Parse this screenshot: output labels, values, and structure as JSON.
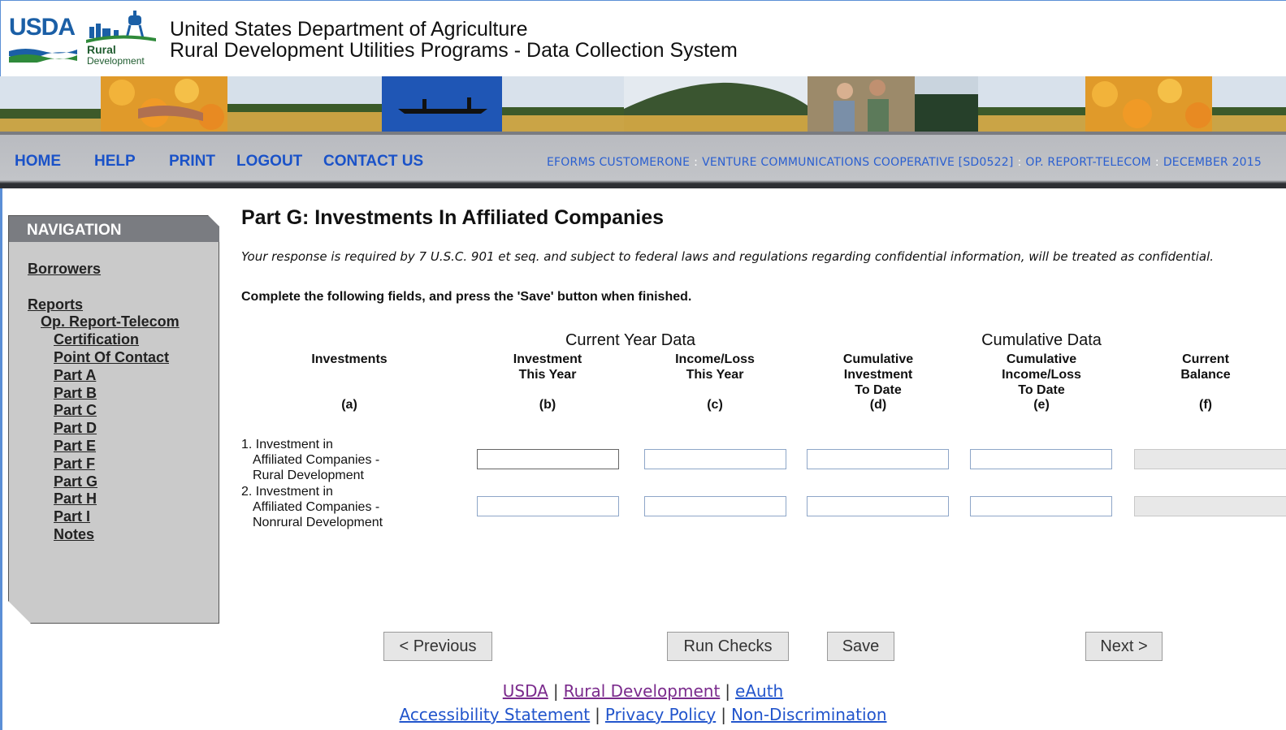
{
  "header": {
    "logo_usda": "USDA",
    "logo_rd_line1": "Rural",
    "logo_rd_line2": "Development",
    "title_line1": "United States Department of Agriculture",
    "title_line2": "Rural Development Utilities Programs - Data Collection System"
  },
  "topnav": {
    "items": [
      {
        "label": "HOME"
      },
      {
        "label": "HELP"
      },
      {
        "label": "PRINT"
      },
      {
        "label": "LOGOUT"
      },
      {
        "label": "CONTACT US"
      }
    ],
    "context": {
      "user": "EFORMS CUSTOMERONE",
      "borrower": "VENTURE COMMUNICATIONS COOPERATIVE [SD0522]",
      "report": "OP. REPORT-TELECOM",
      "period": "DECEMBER 2015",
      "separator": ":"
    }
  },
  "navigation": {
    "title": "NAVIGATION",
    "borrowers": "Borrowers",
    "reports": "Reports",
    "report_name": "Op. Report-Telecom",
    "items": [
      {
        "label": "Certification"
      },
      {
        "label": "Point Of Contact"
      },
      {
        "label": "Part A"
      },
      {
        "label": "Part B"
      },
      {
        "label": "Part C"
      },
      {
        "label": "Part D"
      },
      {
        "label": "Part E"
      },
      {
        "label": "Part F"
      },
      {
        "label": "Part G"
      },
      {
        "label": "Part H"
      },
      {
        "label": "Part I"
      },
      {
        "label": "Notes"
      }
    ]
  },
  "main": {
    "title": "Part G: Investments In Affiliated Companies",
    "notice": "Your response is required by 7 U.S.C. 901 et seq. and subject to federal laws and regulations regarding confidential information, will be treated as confidential.",
    "instructions": "Complete the following fields, and press the 'Save' button when finished.",
    "groups": {
      "current_year": "Current Year Data",
      "cumulative": "Cumulative Data"
    },
    "columns": [
      {
        "line1": "Investments",
        "line2": "",
        "line3": "",
        "letter": "(a)"
      },
      {
        "line1": "Investment",
        "line2": "This Year",
        "line3": "",
        "letter": "(b)"
      },
      {
        "line1": "Income/Loss",
        "line2": "This Year",
        "line3": "",
        "letter": "(c)"
      },
      {
        "line1": "Cumulative",
        "line2": "Investment",
        "line3": "To Date",
        "letter": "(d)"
      },
      {
        "line1": "Cumulative",
        "line2": "Income/Loss",
        "line3": "To Date",
        "letter": "(e)"
      },
      {
        "line1": "Current",
        "line2": "Balance",
        "line3": "",
        "letter": "(f)"
      }
    ],
    "rows": [
      {
        "num": "1.",
        "line1": "Investment in",
        "line2": "Affiliated Companies -",
        "line3": "Rural Development",
        "values": [
          "",
          "",
          "",
          "",
          ""
        ]
      },
      {
        "num": "2.",
        "line1": "Investment in",
        "line2": "Affiliated Companies -",
        "line3": "Nonrural Development",
        "values": [
          "",
          "",
          "",
          "",
          ""
        ]
      }
    ],
    "buttons": {
      "previous": "< Previous",
      "run_checks": "Run Checks",
      "save": "Save",
      "next": "Next >"
    }
  },
  "footer": {
    "links1": [
      "USDA",
      "Rural Development",
      "eAuth"
    ],
    "links2": [
      "Accessibility Statement",
      "Privacy Policy",
      "Non-Discrimination"
    ],
    "separator": "|"
  },
  "colors": {
    "link_blue": "#1a52c8",
    "nav_gray": "#7a7c81",
    "panel_gray": "#cacaca",
    "visited_purple": "#7a2a8c"
  }
}
